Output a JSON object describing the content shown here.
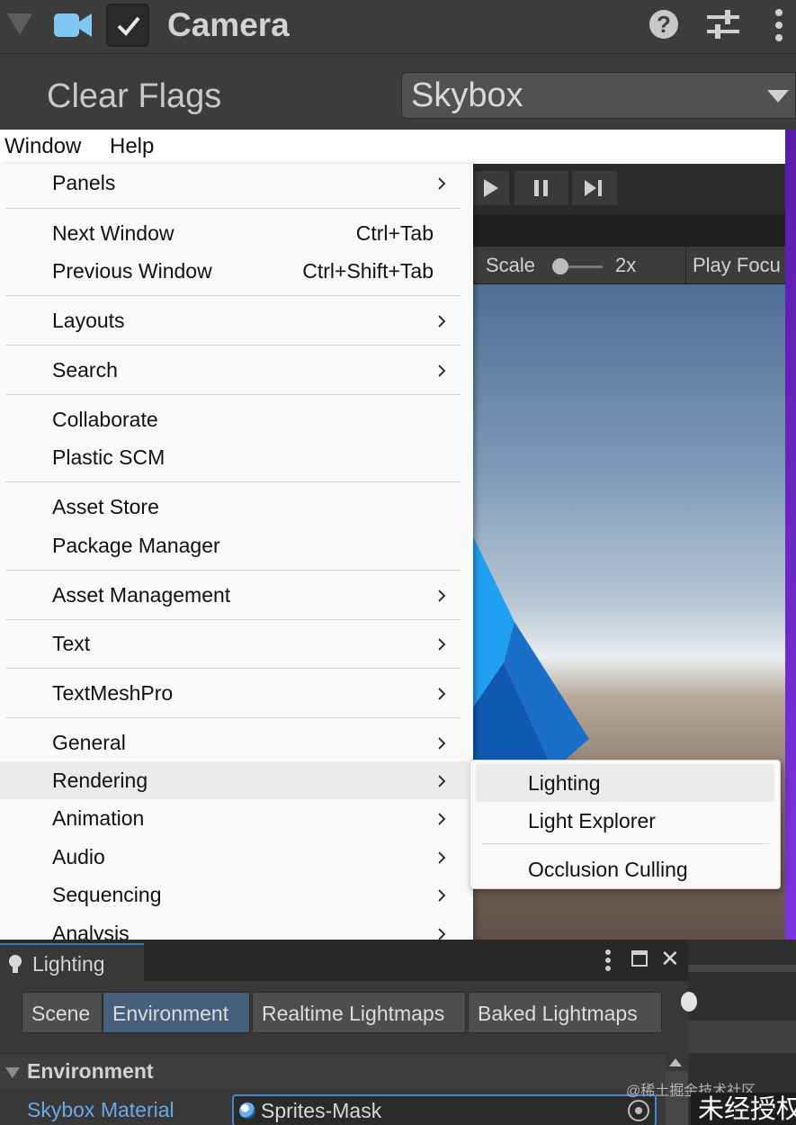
{
  "inspector": {
    "component_title": "Camera",
    "enabled": true,
    "clear_flags": {
      "label": "Clear Flags",
      "value": "Skybox"
    },
    "icons": [
      "camera-icon",
      "help-icon",
      "presets-icon",
      "kebab-menu-icon"
    ]
  },
  "menubar": {
    "items": [
      "Window",
      "Help"
    ]
  },
  "window_menu": {
    "items": [
      {
        "label": "Panels",
        "submenu": true
      },
      {
        "label": "Next Window",
        "shortcut": "Ctrl+Tab"
      },
      {
        "label": "Previous Window",
        "shortcut": "Ctrl+Shift+Tab"
      },
      {
        "label": "Layouts",
        "submenu": true
      },
      {
        "label": "Search",
        "submenu": true
      },
      {
        "label": "Collaborate"
      },
      {
        "label": "Plastic SCM"
      },
      {
        "label": "Asset Store"
      },
      {
        "label": "Package Manager"
      },
      {
        "label": "Asset Management",
        "submenu": true
      },
      {
        "label": "Text",
        "submenu": true
      },
      {
        "label": "TextMeshPro",
        "submenu": true
      },
      {
        "label": "General",
        "submenu": true
      },
      {
        "label": "Rendering",
        "submenu": true,
        "highlighted": true
      },
      {
        "label": "Animation",
        "submenu": true
      },
      {
        "label": "Audio",
        "submenu": true
      },
      {
        "label": "Sequencing",
        "submenu": true
      },
      {
        "label": "Analysis",
        "submenu": true
      }
    ]
  },
  "rendering_submenu": {
    "items": [
      {
        "label": "Lighting",
        "highlighted": true
      },
      {
        "label": "Light Explorer"
      },
      {
        "label": "Occlusion Culling"
      }
    ]
  },
  "game_view": {
    "scale_label": "Scale",
    "scale_value": "2x",
    "play_focus_label": "Play Focu"
  },
  "lighting_window": {
    "tab_title": "Lighting",
    "tabs": [
      {
        "label": "Scene",
        "active": false
      },
      {
        "label": "Environment",
        "active": true
      },
      {
        "label": "Realtime Lightmaps",
        "active": false
      },
      {
        "label": "Baked Lightmaps",
        "active": false
      }
    ],
    "section_title": "Environment",
    "skybox_material": {
      "label": "Skybox Material",
      "value": "Sprites-Mask"
    }
  },
  "watermarks": {
    "site": "@稀土掘金技术社区",
    "notice": "未经授权"
  },
  "colors": {
    "accent": "#3a79bb",
    "active_tab": "#46607c",
    "link_label": "#6aa8e6",
    "menu_bg": "#f9f9f9"
  }
}
